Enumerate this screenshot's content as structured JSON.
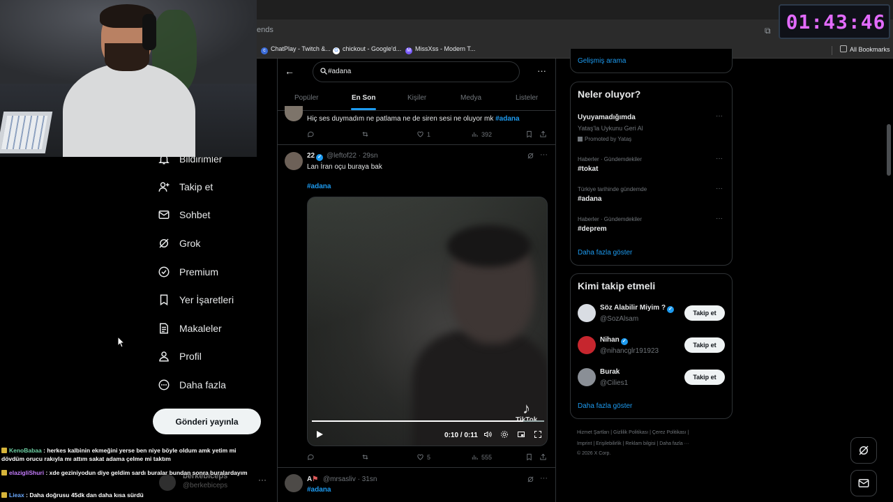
{
  "browser": {
    "url_fragment": "ends",
    "bookmarks": [
      {
        "label": "ChatPlay - Twitch &...",
        "icon": "chatplay-icon"
      },
      {
        "label": "chickout - Google'd...",
        "icon": "google-icon"
      },
      {
        "label": "MissXss - Modern T...",
        "icon": "missxss-icon"
      }
    ],
    "all_bookmarks": "All Bookmarks"
  },
  "timer": "01:43:46",
  "nav": {
    "items": [
      {
        "label": "Bildirimler",
        "icon": "bell-icon"
      },
      {
        "label": "Takip et",
        "icon": "add-user-icon"
      },
      {
        "label": "Sohbet",
        "icon": "mail-icon"
      },
      {
        "label": "Grok",
        "icon": "grok-icon"
      },
      {
        "label": "Premium",
        "icon": "premium-icon"
      },
      {
        "label": "Yer İşaretleri",
        "icon": "bookmark-icon"
      },
      {
        "label": "Makaleler",
        "icon": "article-icon"
      },
      {
        "label": "Profil",
        "icon": "profile-icon"
      },
      {
        "label": "Daha fazla",
        "icon": "more-circle-icon"
      }
    ],
    "post_button": "Gönderi yayınla"
  },
  "account": {
    "name": "berkebiceps",
    "handle": "@berkebiceps"
  },
  "chat": [
    {
      "user": "KenoBabaa",
      "color": "#6fd3a6",
      "message": ": herkes kalbinin ekmeğini yerse ben niye böyle oldum amk yetim mi dövdüm orucu rakıyla mı attım sakat adama çelme mi taktım"
    },
    {
      "user": "elazigliShuri",
      "color": "#c77dff",
      "message": ": xde geziniyodun diye geldim sardı buralar bundan sonra buralardayım"
    },
    {
      "user": "Lieax",
      "color": "#6aa9ff",
      "message": ": Daha doğrusu 45dk dan daha kısa sürdü"
    }
  ],
  "search": {
    "value": "#adana"
  },
  "tabs": [
    "Popüler",
    "En Son",
    "Kişiler",
    "Medya",
    "Listeler"
  ],
  "active_tab": "En Son",
  "tweet1": {
    "text": "Hiç ses duymadım ne patlama ne de siren sesi ne oluyor mk",
    "hashtag": "#adana",
    "likes": "1",
    "views": "392"
  },
  "tweet2": {
    "name": "22",
    "handle": "@leftof22 · 29sn",
    "text": "Lan İran oçu buraya bak",
    "hashtag": "#adana",
    "video": {
      "time": "0:10 / 0:11",
      "progress": 0.91,
      "watermark": "TikTok"
    },
    "likes": "5",
    "views": "555"
  },
  "tweet3": {
    "name": "A",
    "handle": "@mrsasliv · 31sn",
    "hashtag": "#adana"
  },
  "right": {
    "advanced_search": "Gelişmiş arama",
    "trends_title": "Neler oluyor?",
    "trends": [
      {
        "meta": "",
        "name": "Uyuyamadığımda",
        "sub": "Yataş'la Uykunu Geri Al",
        "promo": "Promoted by Yataş"
      },
      {
        "meta": "Haberler · Gündemdekiler",
        "name": "#tokat"
      },
      {
        "meta": "Türkiye tarihinde gündemde",
        "name": "#adana"
      },
      {
        "meta": "Haberler · Gündemdekiler",
        "name": "#deprem"
      }
    ],
    "show_more": "Daha fazla göster",
    "who_title": "Kimi takip etmeli",
    "who": [
      {
        "name": "Söz Alabilir Miyim ?",
        "handle": "@SozAlsam",
        "button": "Takip et",
        "color": "#d9dde3"
      },
      {
        "name": "Nihan",
        "handle": "@nihancglr191923",
        "button": "Takip et",
        "color": "#c6262e"
      },
      {
        "name": "Burak",
        "handle": "@Cilies1",
        "button": "Takip et",
        "color": "#8a8f96"
      }
    ],
    "who_more": "Daha fazla göster",
    "footer1": "Hizmet Şartları  |  Gizlilik Politikası  |  Çerez Politikası  |",
    "footer2": "Imprint  |  Erişilebilirlik  |  Reklam bilgisi  |  Daha fazla ···",
    "footer3": "© 2026 X Corp."
  }
}
